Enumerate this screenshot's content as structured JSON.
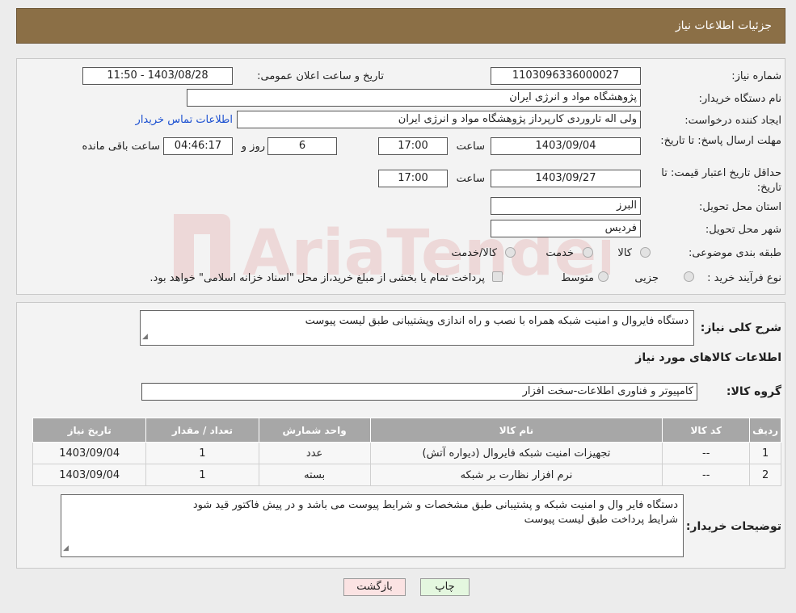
{
  "header": {
    "title": "جزئیات اطلاعات نیاز"
  },
  "form": {
    "need_number_label": "شماره نیاز:",
    "need_number": "1103096336000027",
    "announce_label": "تاریخ و ساعت اعلان عمومی:",
    "announce_value": "1403/08/28 - 11:50",
    "buyer_org_label": "نام دستگاه خریدار:",
    "buyer_org": "پژوهشگاه مواد و انرژی ایران",
    "creator_label": "ایجاد کننده درخواست:",
    "creator": "ولی اله تاروردی کارپرداز پژوهشگاه مواد و انرژی ایران",
    "contact_link": "اطلاعات تماس خریدار",
    "deadline_label": "مهلت ارسال پاسخ: تا تاریخ:",
    "deadline_date": "1403/09/04",
    "time_label": "ساعت",
    "deadline_time": "17:00",
    "days_value": "6",
    "days_label": "روز و",
    "remaining_time": "04:46:17",
    "remaining_label": "ساعت باقی مانده",
    "validity_label": "حداقل تاریخ اعتبار قیمت: تا تاریخ:",
    "validity_date": "1403/09/27",
    "validity_time": "17:00",
    "province_label": "استان محل تحویل:",
    "province": "البرز",
    "city_label": "شهر محل تحویل:",
    "city": "فردیس",
    "category_label": "طبقه بندی موضوعی:",
    "category_options": [
      "کالا",
      "خدمت",
      "کالا/خدمت"
    ],
    "process_label": "نوع فرآیند خرید :",
    "process_options": [
      "جزیی",
      "متوسط"
    ],
    "process_note": "پرداخت تمام یا بخشی از مبلغ خرید،از محل \"اسناد خزانه اسلامی\" خواهد بود."
  },
  "details": {
    "summary_label": "شرح کلی نیاز:",
    "summary": "دستگاه فایروال و امنیت شبکه همراه با نصب و راه اندازی وپشتیبانی طبق لیست پیوست",
    "goods_title": "اطلاعات کالاهای مورد نیاز",
    "goods_group_label": "گروه کالا:",
    "goods_group": "کامپیوتر و فناوری اطلاعات-سخت افزار",
    "table": {
      "headers": [
        "ردیف",
        "کد کالا",
        "نام کالا",
        "واحد شمارش",
        "تعداد / مقدار",
        "تاریخ نیاز"
      ],
      "rows": [
        [
          "1",
          "--",
          "تجهیزات امنیت شبکه فایروال (دیواره آتش)",
          "عدد",
          "1",
          "1403/09/04"
        ],
        [
          "2",
          "--",
          "نرم افزار نظارت بر شبکه",
          "بسته",
          "1",
          "1403/09/04"
        ]
      ]
    },
    "notes_label": "توضیحات خریدار:",
    "notes_line1": "دستگاه فایر وال و امنیت شبکه و پشتیبانی طبق مشخصات و شرایط پیوست می باشد و در پیش فاکتور قید شود",
    "notes_line2": "شرایط پرداخت طبق لیست پیوست"
  },
  "buttons": {
    "print": "چاپ",
    "back": "بازگشت"
  },
  "watermark_text": "AriaTender.neT",
  "colors": {
    "header": "#8b6f46",
    "link": "#1a4fd1",
    "table_head": "#a7a7a7",
    "print_btn": "#e4f7df",
    "back_btn": "#fbe3e3"
  }
}
